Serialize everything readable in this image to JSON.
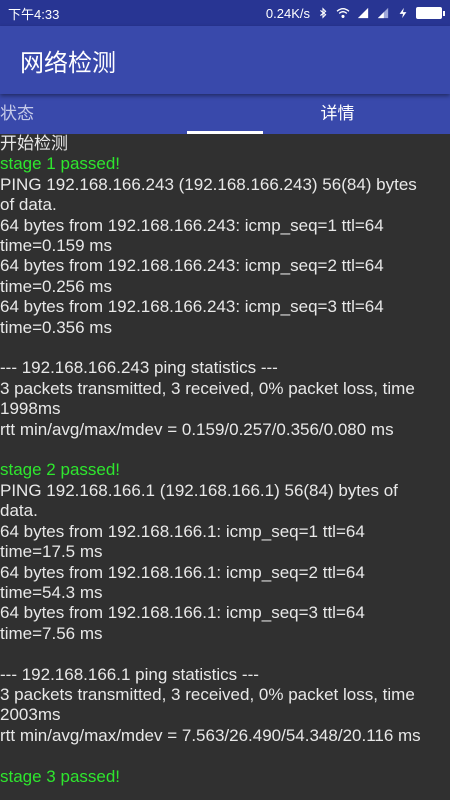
{
  "status_bar": {
    "time": "下午4:33",
    "speed": "0.24K/s",
    "battery_level": 1.0
  },
  "app": {
    "title": "网络检测"
  },
  "tabs": [
    {
      "label": "状态",
      "active": false
    },
    {
      "label": "详情",
      "active": true
    }
  ],
  "log": {
    "start": "开始检测",
    "stage1": {
      "passed": "stage 1 passed!",
      "lines": [
        "PING 192.168.166.243 (192.168.166.243) 56(84) bytes of data.",
        "64 bytes from 192.168.166.243: icmp_seq=1 ttl=64 time=0.159 ms",
        "64 bytes from 192.168.166.243: icmp_seq=2 ttl=64 time=0.256 ms",
        "64 bytes from 192.168.166.243: icmp_seq=3 ttl=64 time=0.356 ms"
      ],
      "stats_header": "--- 192.168.166.243 ping statistics ---",
      "stats": [
        "3 packets transmitted, 3 received, 0% packet loss, time 1998ms",
        "rtt min/avg/max/mdev = 0.159/0.257/0.356/0.080 ms"
      ]
    },
    "stage2": {
      "passed": "stage 2 passed!",
      "lines": [
        "PING 192.168.166.1 (192.168.166.1) 56(84) bytes of data.",
        "64 bytes from 192.168.166.1: icmp_seq=1 ttl=64 time=17.5 ms",
        "64 bytes from 192.168.166.1: icmp_seq=2 ttl=64 time=54.3 ms",
        "64 bytes from 192.168.166.1: icmp_seq=3 ttl=64 time=7.56 ms"
      ],
      "stats_header": "--- 192.168.166.1 ping statistics ---",
      "stats": [
        "3 packets transmitted, 3 received, 0% packet loss, time 2003ms",
        "rtt min/avg/max/mdev = 7.563/26.490/54.348/20.116 ms"
      ]
    },
    "stage3_partial": "stage 3 passed!"
  },
  "colors": {
    "status_bar": "#283593",
    "app_bar": "#3949ab",
    "background": "#303030",
    "pass_text": "#2ee62e"
  }
}
